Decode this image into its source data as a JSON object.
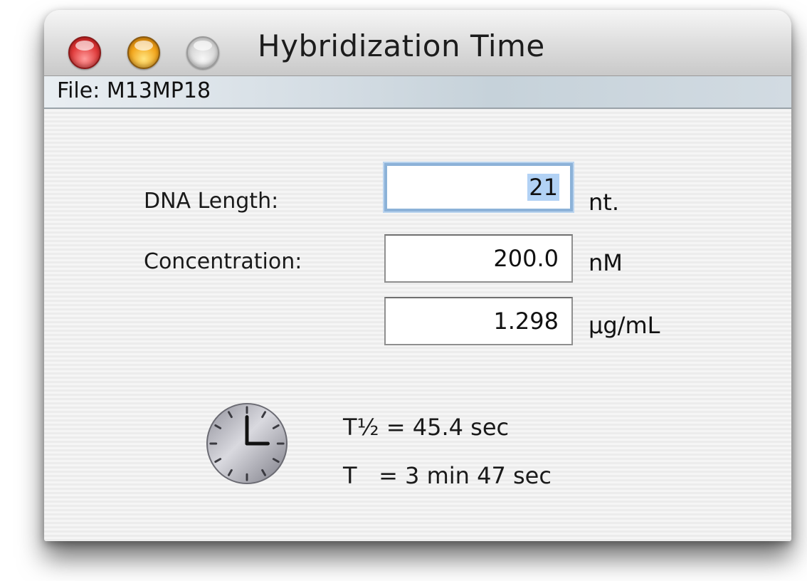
{
  "window": {
    "title": "Hybridization Time"
  },
  "filebar": {
    "text": "File: M13MP18"
  },
  "form": {
    "dna_length_label": "DNA Length:",
    "dna_length_value": "21",
    "dna_length_unit": "nt.",
    "concentration_label": "Concentration:",
    "concentration_nm_value": "200.0",
    "concentration_nm_unit": "nM",
    "concentration_ug_value": "1.298",
    "concentration_ug_unit": "µg/mL"
  },
  "results": {
    "t_half": "T½ = 45.4 sec",
    "t_total": "T   = 3 min 47 sec"
  },
  "icons": {
    "close": "close-icon",
    "minimize": "minimize-icon",
    "zoom": "zoom-icon",
    "clock": "clock-icon"
  }
}
